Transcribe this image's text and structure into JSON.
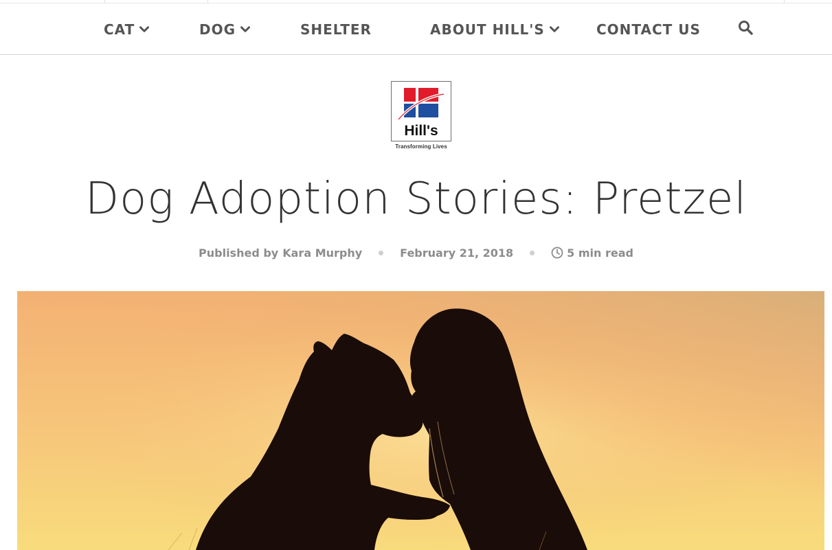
{
  "nav": {
    "items": [
      {
        "label": "CAT",
        "has_dropdown": true
      },
      {
        "label": "DOG",
        "has_dropdown": true
      },
      {
        "label": "SHELTER",
        "has_dropdown": false
      },
      {
        "label": "ABOUT HILL'S",
        "has_dropdown": true
      },
      {
        "label": "CONTACT US",
        "has_dropdown": false
      }
    ],
    "search_icon": "search-icon"
  },
  "logo": {
    "brand": "Hill's",
    "tagline": "Transforming Lives"
  },
  "article": {
    "title": "Dog Adoption Stories: Pretzel",
    "published_by_label": "Published by",
    "author": "Kara Murphy",
    "date": "February 21, 2018",
    "read_time": "5 min read"
  },
  "hero": {
    "description": "Silhouette of a dog and a girl touching noses at sunset"
  },
  "colors": {
    "nav_text": "#555555",
    "logo_red": "#e11b2a",
    "logo_blue": "#1e4fa0",
    "meta_text": "#8c8c8c",
    "sunset_orange": "#f2a54d"
  }
}
